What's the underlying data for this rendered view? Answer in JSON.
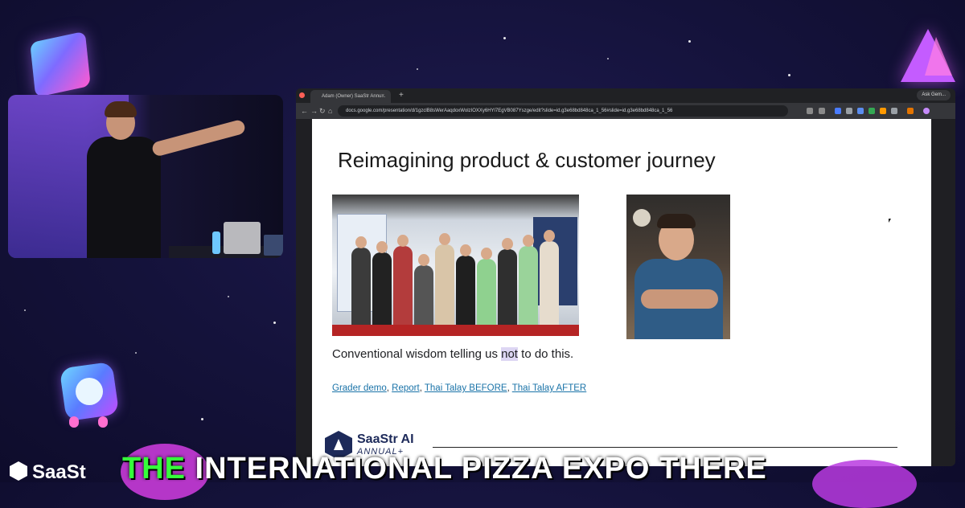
{
  "browser": {
    "tab_title": "Adam (Owner) SaaStr Annu...",
    "tab_close": "×",
    "new_tab": "+",
    "ask_label": "Ask Gem...",
    "url": "docs.google.com/presentation/d/1gzclB8sWerAaqdoxWolzIOXXy6HYl7EgVB087Yszge/edit?slide=id.g3e68bd848ca_1_56#slide=id.g3e68bd848ca_1_56",
    "back": "←",
    "forward": "→",
    "reload": "↻",
    "home": "⌂"
  },
  "slide": {
    "title": "Reimagining product & customer journey",
    "caption_before": "Conventional wisdom telling us ",
    "caption_highlight": "not",
    "caption_after": " to do this.",
    "links": [
      "Grader demo",
      "Report",
      "Thai Talay BEFORE",
      "Thai Talay AFTER"
    ],
    "separator": ", ",
    "logo_name": "SaaStr AI",
    "logo_sub": "ANNUAL+"
  },
  "overlay": {
    "brand": "SaaSt",
    "subtitle_highlight": "THE",
    "subtitle_rest": " INTERNATIONAL PIZZA EXPO THERE"
  },
  "icons": [
    "cube-icon",
    "prism-icon",
    "mascot-icon",
    "saastr-logo-icon"
  ],
  "colors": {
    "background": "#14123a",
    "subtitle_highlight": "#35ff3a",
    "link": "#1a73a8",
    "accent_purple": "#c45cff"
  }
}
